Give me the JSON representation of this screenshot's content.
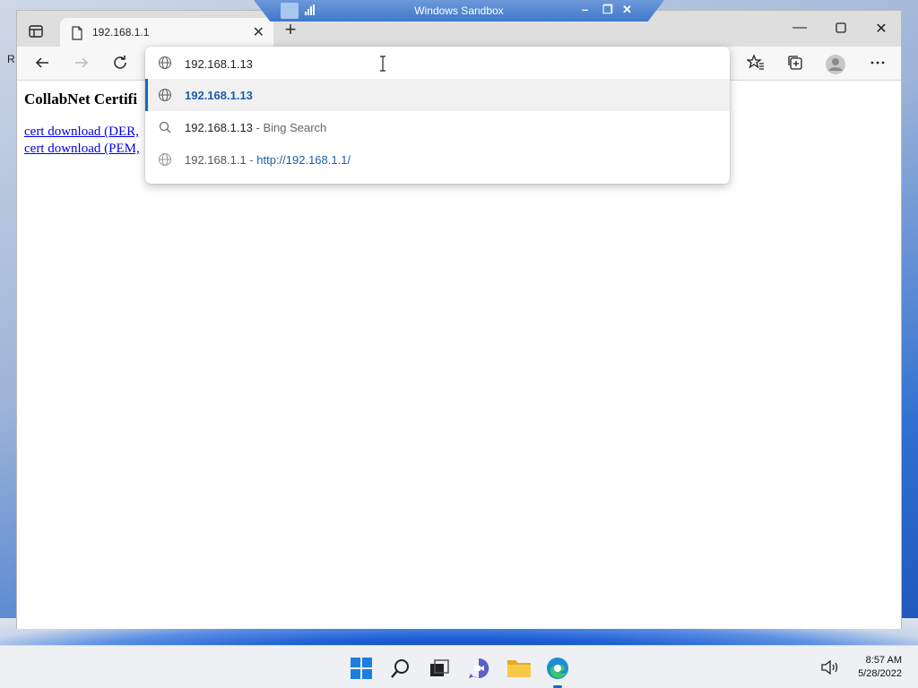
{
  "desktop": {
    "fragment_text": "R"
  },
  "sandbox": {
    "title": "Windows Sandbox"
  },
  "browser": {
    "tab": {
      "title": "192.168.1.1"
    },
    "address": {
      "value": "192.168.1.13"
    },
    "suggestions": [
      {
        "icon": "globe-icon",
        "text": "192.168.1.13",
        "extra": "",
        "url": "",
        "selected": true
      },
      {
        "icon": "search-icon",
        "text": "192.168.1.13",
        "extra": " - Bing Search",
        "url": "",
        "selected": false
      },
      {
        "icon": "globe-icon",
        "text": "192.168.1.1",
        "extra": " - ",
        "url": "http://192.168.1.1/",
        "selected": false
      }
    ]
  },
  "page": {
    "heading": "CollabNet Certifi",
    "links": [
      "cert download (DER,",
      "cert download (PEM,"
    ]
  },
  "taskbar": {
    "time": "8:57 AM",
    "date": "5/28/2022",
    "apps": [
      "start-icon",
      "search-icon",
      "task-view-icon",
      "chat-icon",
      "file-explorer-icon",
      "edge-icon"
    ]
  },
  "colors": {
    "accent": "#0f6cbd",
    "link": "#0000ee",
    "sandbox_bar": "#3f78c9"
  }
}
